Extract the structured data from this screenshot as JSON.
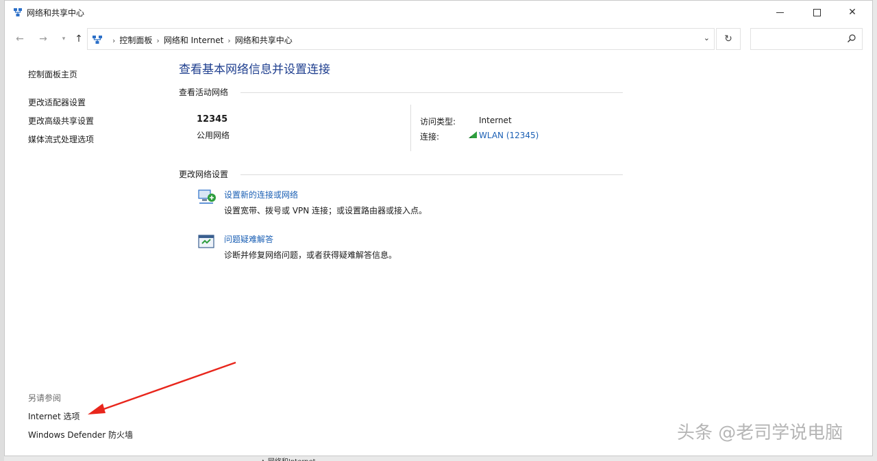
{
  "window": {
    "title": "网络和共享中心",
    "controls": {
      "minimize": "–",
      "maximize": "□",
      "close": "✕"
    }
  },
  "nav": {
    "back": "←",
    "forward": "→",
    "recent": "▾",
    "up": "↑",
    "breadcrumbs": [
      "控制面板",
      "网络和 Internet",
      "网络和共享中心"
    ],
    "breadcrumb_sep": "›",
    "dropdown": "⌄",
    "refresh": "↻",
    "search_placeholder": ""
  },
  "sidebar": {
    "home": "控制面板主页",
    "items": [
      "更改适配器设置",
      "更改高级共享设置",
      "媒体流式处理选项"
    ],
    "see_also_label": "另请参阅",
    "see_also": [
      "Internet 选项",
      "Windows Defender 防火墙"
    ]
  },
  "main": {
    "title": "查看基本网络信息并设置连接",
    "active_section": "查看活动网络",
    "network": {
      "name": "12345",
      "type": "公用网络",
      "access_label": "访问类型:",
      "access_value": "Internet",
      "connection_label": "连接:",
      "connection_value": "WLAN (12345)"
    },
    "change_section": "更改网络设置",
    "tasks": [
      {
        "link": "设置新的连接或网络",
        "desc": "设置宽带、拨号或 VPN 连接；或设置路由器或接入点。"
      },
      {
        "link": "问题疑难解答",
        "desc": "诊断并修复网络问题，或者获得疑难解答信息。"
      }
    ]
  },
  "overlay": {
    "watermark": "头条 @老司学说电脑",
    "arrow_color": "#e8261c",
    "bottom_peek": "▲  网络和Internet"
  },
  "colors": {
    "title_blue": "#1f3f8f",
    "link_blue": "#1a5fb4",
    "signal_green": "#2e9e3e"
  }
}
